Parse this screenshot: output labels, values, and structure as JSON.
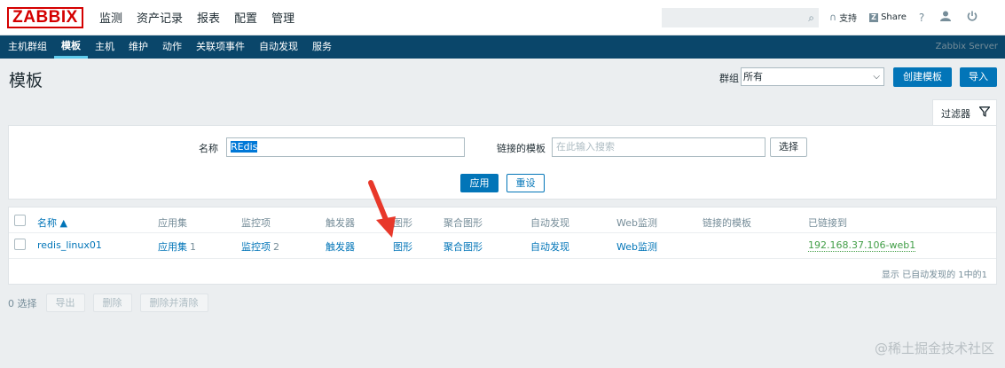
{
  "logo": "ZABBIX",
  "main_menu": [
    "监测",
    "资产记录",
    "报表",
    "配置",
    "管理"
  ],
  "top_right": {
    "support": "支持",
    "share": "Share",
    "share_badge": "Z",
    "help": "?",
    "user_icon": "user-icon",
    "power_icon": "power-icon"
  },
  "sub_menu": [
    "主机群组",
    "模板",
    "主机",
    "维护",
    "动作",
    "关联项事件",
    "自动发现",
    "服务"
  ],
  "server_name": "Zabbix Server",
  "page": {
    "title": "模板",
    "group_label": "群组",
    "group_value": "所有",
    "create_button": "创建模板",
    "import_button": "导入"
  },
  "filter": {
    "tab_label": "过滤器",
    "name_label": "名称",
    "name_value": "REdis",
    "linked_label": "链接的模板",
    "linked_placeholder": "在此输入搜索",
    "select_button": "选择",
    "apply_button": "应用",
    "reset_button": "重设"
  },
  "table": {
    "headers": [
      "名称 ▲",
      "应用集",
      "监控项",
      "触发器",
      "图形",
      "聚合图形",
      "自动发现",
      "Web监测",
      "链接的模板",
      "已链接到"
    ],
    "rows": [
      {
        "name": "redis_linux01",
        "applications": "应用集",
        "applications_count": "1",
        "items": "监控项",
        "items_count": "2",
        "triggers": "触发器",
        "graphs": "图形",
        "screens": "聚合图形",
        "discovery": "自动发现",
        "web": "Web监测",
        "linked_templates": "",
        "linked_to": "192.168.37.106-web1"
      }
    ],
    "footer": "显示 已自动发现的 1中的1"
  },
  "bottom": {
    "selected": "0 选择",
    "export": "导出",
    "delete": "删除",
    "delete_clear": "删除并清除"
  },
  "watermark": "@稀土掘金技术社区",
  "colors": {
    "brand_red": "#d40000",
    "nav_blue": "#0a466a",
    "link_blue": "#0275b8",
    "linked_green": "#429e47",
    "arrow_red": "#e8382a"
  }
}
